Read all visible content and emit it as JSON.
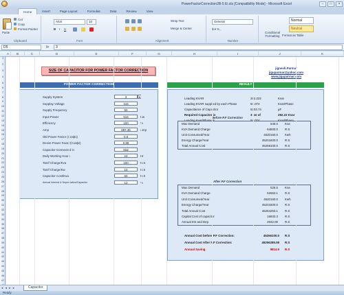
{
  "window": {
    "title": "PowerFactorCorrection2B-5 Ei.xls  [Compatibility Mode] - Microsoft Excel"
  },
  "tabs": [
    "Home",
    "Insert",
    "Page Layout",
    "Formulas",
    "Data",
    "Review",
    "View"
  ],
  "ribbon": {
    "clipboard": {
      "label": "Clipboard",
      "paste": "Paste",
      "cut": "Cut",
      "copy": "Copy",
      "format_painter": "Format Painter"
    },
    "font": {
      "label": "Font",
      "name": "Arial",
      "size": "10"
    },
    "alignment": {
      "label": "Alignment",
      "wrap": "Wrap Text",
      "merge": "Merge & Center"
    },
    "number": {
      "label": "Number",
      "format": "General"
    },
    "styles": {
      "conditional": "Conditional Formatting",
      "format_table": "Format as Table",
      "normal": "Normal",
      "neutral": "Neutral"
    }
  },
  "formula_bar": {
    "cell": "D5",
    "fx": "fx",
    "content": "3"
  },
  "columns": [
    "A",
    "B",
    "C",
    "D",
    "E",
    "F",
    "G",
    "H",
    "I",
    "J",
    "K"
  ],
  "rows": [
    "1",
    "2",
    "3",
    "4",
    "5",
    "6",
    "7",
    "8",
    "9",
    "10",
    "11",
    "12",
    "13",
    "14",
    "15",
    "16",
    "17",
    "18",
    "19",
    "20",
    "21",
    "22",
    "23",
    "24",
    "25",
    "26",
    "27",
    "28",
    "29",
    "30",
    "31",
    "32",
    "33",
    "34",
    "35",
    "36",
    "37",
    "38",
    "39",
    "40",
    "41",
    "42",
    "43",
    "44",
    "45",
    "46",
    "47",
    "48"
  ],
  "sheet": {
    "title": "SIZE OF CAPACITOR FOR POWER FACTOR CORRECTION",
    "contact": [
      "jignesh.Parmar",
      "jiguparmar@yahoo.com",
      "www.jiguparmar.com"
    ],
    "left_header": "POWER FACTOR CORRECTION",
    "right_header": "RESULT",
    "inputs": [
      {
        "label": "Supply System",
        "value": "3",
        "unit": ""
      },
      {
        "label": "Supplay Voltage",
        "value": "415",
        "unit": ""
      },
      {
        "label": "Supply Frequency",
        "value": "50",
        "unit": ""
      },
      {
        "label": "Input Power",
        "value": "516",
        "unit": "Kw"
      },
      {
        "label": "Efficiency",
        "value": "100",
        "unit": "%"
      },
      {
        "label": "Amp",
        "value": "897.35",
        "unit": "Amp"
      },
      {
        "label": "Old Power Factor (Cosɸ1)",
        "value": "0.8",
        "unit": ""
      },
      {
        "label": "Desire Power Factor(Cosɸ2)",
        "value": "0.98",
        "unit": ""
      },
      {
        "label": "Capacitor Connected in",
        "value": "Star",
        "unit": ""
      },
      {
        "label": "Daily Working Hours",
        "value": "24",
        "unit": "Hr"
      },
      {
        "label": "Tarrif Charge/Kva",
        "value": "100",
        "unit": "R.S"
      },
      {
        "label": "Tarrif Charge/Kw",
        "value": "10",
        "unit": "R.S"
      },
      {
        "label": "Capacitor Cost/Kva",
        "value": "60",
        "unit": "R.S"
      },
      {
        "label": "Annual Interest & Depreciation/Capacitor",
        "value": "12",
        "unit": "%"
      }
    ],
    "top_results": [
      {
        "label": "Leading KVAR",
        "value": "282.222",
        "unit": "Kvar"
      },
      {
        "label": "Leading KVAR supplied by each Phase",
        "value": "94.074",
        "unit": "Kvar/Phase"
      },
      {
        "label": "Capacitance of Capacitor",
        "value": "5203.74",
        "unit": "µF"
      },
      {
        "label": "Required Capacitor is",
        "value": "3 No of",
        "unit": "282.22 Kvar"
      },
      {
        "label": "Leading Kvar/Phase is",
        "value": "94.074",
        "unit": "Kvar/Phase"
      }
    ],
    "before_title": "Before P.F Correction",
    "before": [
      {
        "label": "Max Demand",
        "value": "645.0",
        "unit": "Kva"
      },
      {
        "label": "KVA Demand Charge",
        "value": "64500.0",
        "unit": "R.S"
      },
      {
        "label": "Unit Consumed/Year",
        "value": "4520160.0",
        "unit": "Kwh"
      },
      {
        "label": "Energy Charge/Year",
        "value": "45201600.0",
        "unit": "R.S"
      },
      {
        "label": "Total Annual Cost",
        "value": "45266100.0",
        "unit": "R.S"
      }
    ],
    "after_title": "After P.F Correction",
    "after": [
      {
        "label": "Max Demand",
        "value": "526.5",
        "unit": "Kva"
      },
      {
        "label": "KVA Demand Charge",
        "value": "52653.1",
        "unit": "R.S"
      },
      {
        "label": "Unit Consumed/Year",
        "value": "4520160.0",
        "unit": "Kwh"
      },
      {
        "label": "Energy Charge/Year",
        "value": "45201600.0",
        "unit": "R.S"
      },
      {
        "label": "Total Annual Cost",
        "value": "45254253.1",
        "unit": "R.S"
      },
      {
        "label": "Capital Cost of capacitor",
        "value": "16933.3",
        "unit": "R.S"
      },
      {
        "label": "Annual Intr and Dep",
        "value": "2032.00",
        "unit": "R.S"
      }
    ],
    "summary": [
      {
        "label": "Annual Cost before P.F Correction:",
        "value": "45266100.0",
        "unit": "R.S"
      },
      {
        "label": "Annual Cost After P.F Correction:",
        "value": "45256285.08",
        "unit": "R.S"
      },
      {
        "label": "Annual Saving",
        "value": "9814.9",
        "unit": "R.S"
      }
    ]
  },
  "sheet_tabs": {
    "active": "Capacitor",
    "nav": "◂ ◂ ▸ ▸"
  },
  "status": {
    "text": "Ready"
  },
  "colors": {
    "left_header": "#3b6db0",
    "right_header": "#2aa24a",
    "title_bg": "#ffb6b6",
    "saving": "#d00000"
  }
}
